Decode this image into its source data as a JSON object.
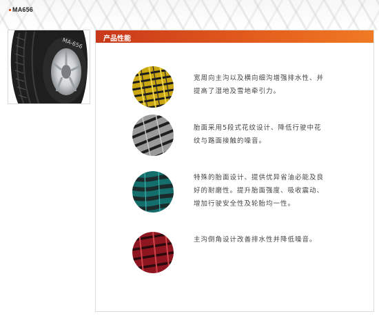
{
  "product": {
    "model": "MA656"
  },
  "section": {
    "title": "产品性能"
  },
  "features": [
    {
      "icon": "yellow-tread-icon",
      "color": "#e6c21c",
      "lines": [
        "宽周向主沟以及横向细沟增强排水性、并",
        "提高了湿地及雪地牵引力。"
      ]
    },
    {
      "icon": "gray-tread-icon",
      "color": "#8a8a8a",
      "lines": [
        "胎面采用5段式花纹设计、降低行驶中花",
        "纹与路面接触的噪音。"
      ]
    },
    {
      "icon": "teal-tread-icon",
      "color": "#1f8a87",
      "lines": [
        "特殊的胎面设计、提供优异省油必能及良",
        "好的耐磨性。提升胎面强度、吸收震动、",
        "增加行驶安全性及轮胎均一性。"
      ]
    },
    {
      "icon": "red-tread-icon",
      "color": "#b01e28",
      "lines": [
        "主沟倒角设计改善排水性并降低噪音。"
      ]
    }
  ]
}
